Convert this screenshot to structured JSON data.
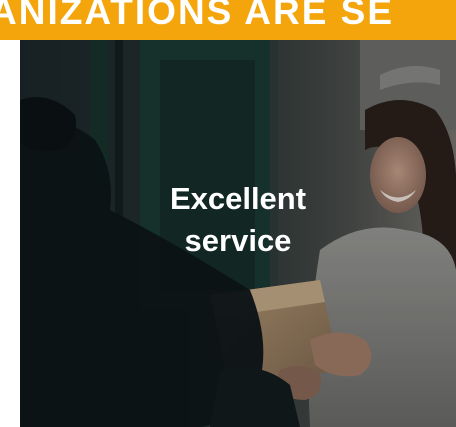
{
  "banner": {
    "text": "ANIZATIONS ARE SE",
    "color": "#f3a50b"
  },
  "card": {
    "title": "Excellent\nservice",
    "image_description_icon": "photo-delivery"
  }
}
